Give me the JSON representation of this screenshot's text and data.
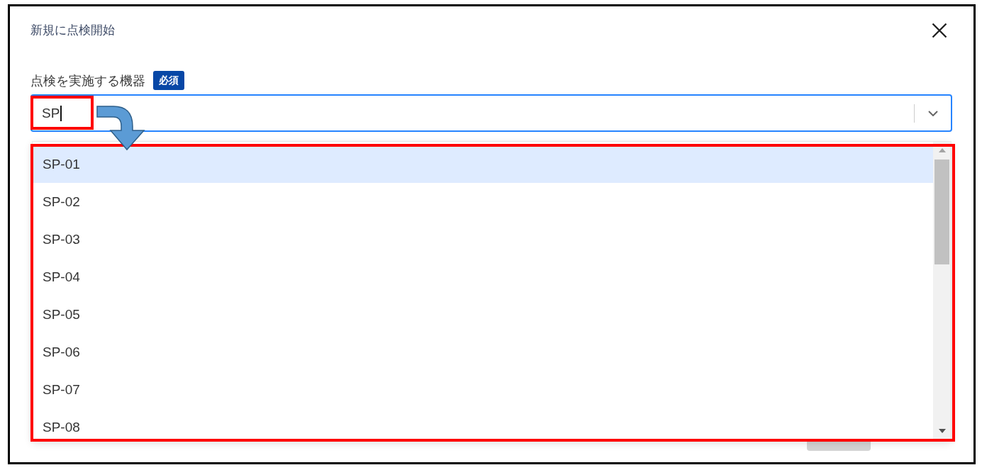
{
  "dialog": {
    "title": "新規に点検開始"
  },
  "field": {
    "label": "点検を実施する機器",
    "required_badge": "必須",
    "value": "SP",
    "focused": true,
    "expanded": true
  },
  "dropdown": {
    "options": [
      {
        "label": "SP-01",
        "selected": true
      },
      {
        "label": "SP-02",
        "selected": false
      },
      {
        "label": "SP-03",
        "selected": false
      },
      {
        "label": "SP-04",
        "selected": false
      },
      {
        "label": "SP-05",
        "selected": false
      },
      {
        "label": "SP-06",
        "selected": false
      },
      {
        "label": "SP-07",
        "selected": false
      },
      {
        "label": "SP-08",
        "selected": false
      }
    ]
  }
}
